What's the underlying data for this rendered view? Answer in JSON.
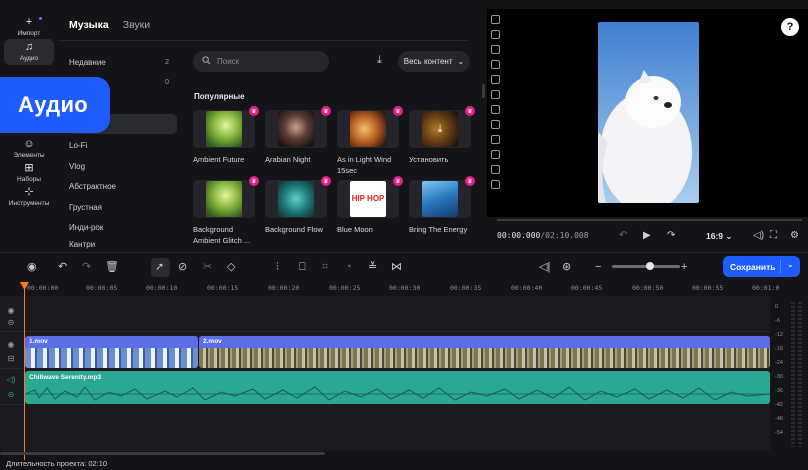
{
  "rail": {
    "items": [
      {
        "label": "Импорт",
        "icon": "plus-icon"
      },
      {
        "label": "Аудио",
        "icon": "music-note-icon"
      },
      {
        "label": "Элементы",
        "icon": "smile-icon"
      },
      {
        "label": "Наборы",
        "icon": "add-set-icon"
      },
      {
        "label": "Инструменты",
        "icon": "tools-grid-icon"
      }
    ]
  },
  "callout": {
    "label": "Аудио"
  },
  "library": {
    "tabs": [
      "Музыка",
      "Звуки"
    ],
    "categories": [
      {
        "label": "Недавние",
        "count": "2"
      },
      {
        "label": "",
        "count": "0"
      },
      {
        "label": "",
        "count": ""
      },
      {
        "label": "ые",
        "count": ""
      },
      {
        "label": "Lo-Fi",
        "count": ""
      },
      {
        "label": "Vlog",
        "count": ""
      },
      {
        "label": "Абстрактное",
        "count": ""
      },
      {
        "label": "Грустная",
        "count": ""
      },
      {
        "label": "Инди-рок",
        "count": ""
      },
      {
        "label": "Кантри",
        "count": ""
      }
    ],
    "search_placeholder": "Поиск",
    "content_filter": "Весь контент",
    "section_title": "Популярные",
    "cards": [
      {
        "title": "Ambient Future"
      },
      {
        "title": "Arabian Night"
      },
      {
        "title": "As in Light Wind 15sec"
      },
      {
        "title": "Установить"
      },
      {
        "title": "Background Ambient Glitch ..."
      },
      {
        "title": "Background Flow"
      },
      {
        "title": "Blue Moon"
      },
      {
        "title": "Bring The Energy"
      }
    ],
    "hiphop_text": "HIP HOP"
  },
  "player": {
    "time_current": "00:00.000",
    "time_total": "/02:10.008",
    "aspect_ratio": "16:9",
    "help": "?"
  },
  "toolbar": {
    "save_label": "Сохранить"
  },
  "ruler": {
    "ticks": [
      "00:00:00",
      "00:00:05",
      "00:00:10",
      "00:00:15",
      "00:00:20",
      "00:00:25",
      "00:00:30",
      "00:00:35",
      "00:00:40",
      "00:00:45",
      "00:00:50",
      "00:00:55",
      "00:01:0"
    ]
  },
  "timeline": {
    "video_clips": [
      "1.mov",
      "2.mov"
    ],
    "audio_clip": "Chillwave Serenity.mp3"
  },
  "meter": {
    "labels": [
      "0",
      "-6",
      "-12",
      "-18",
      "-24",
      "-30",
      "-36",
      "-42",
      "-48",
      "-54"
    ]
  },
  "status": {
    "duration": "Длительность проекта: 02:10"
  },
  "colors": {
    "accent": "#1f5cff",
    "video_clip": "#5b6ee8",
    "audio_clip": "#2aa894",
    "playhead": "#ff7a1a",
    "crown": "#e0218a"
  }
}
